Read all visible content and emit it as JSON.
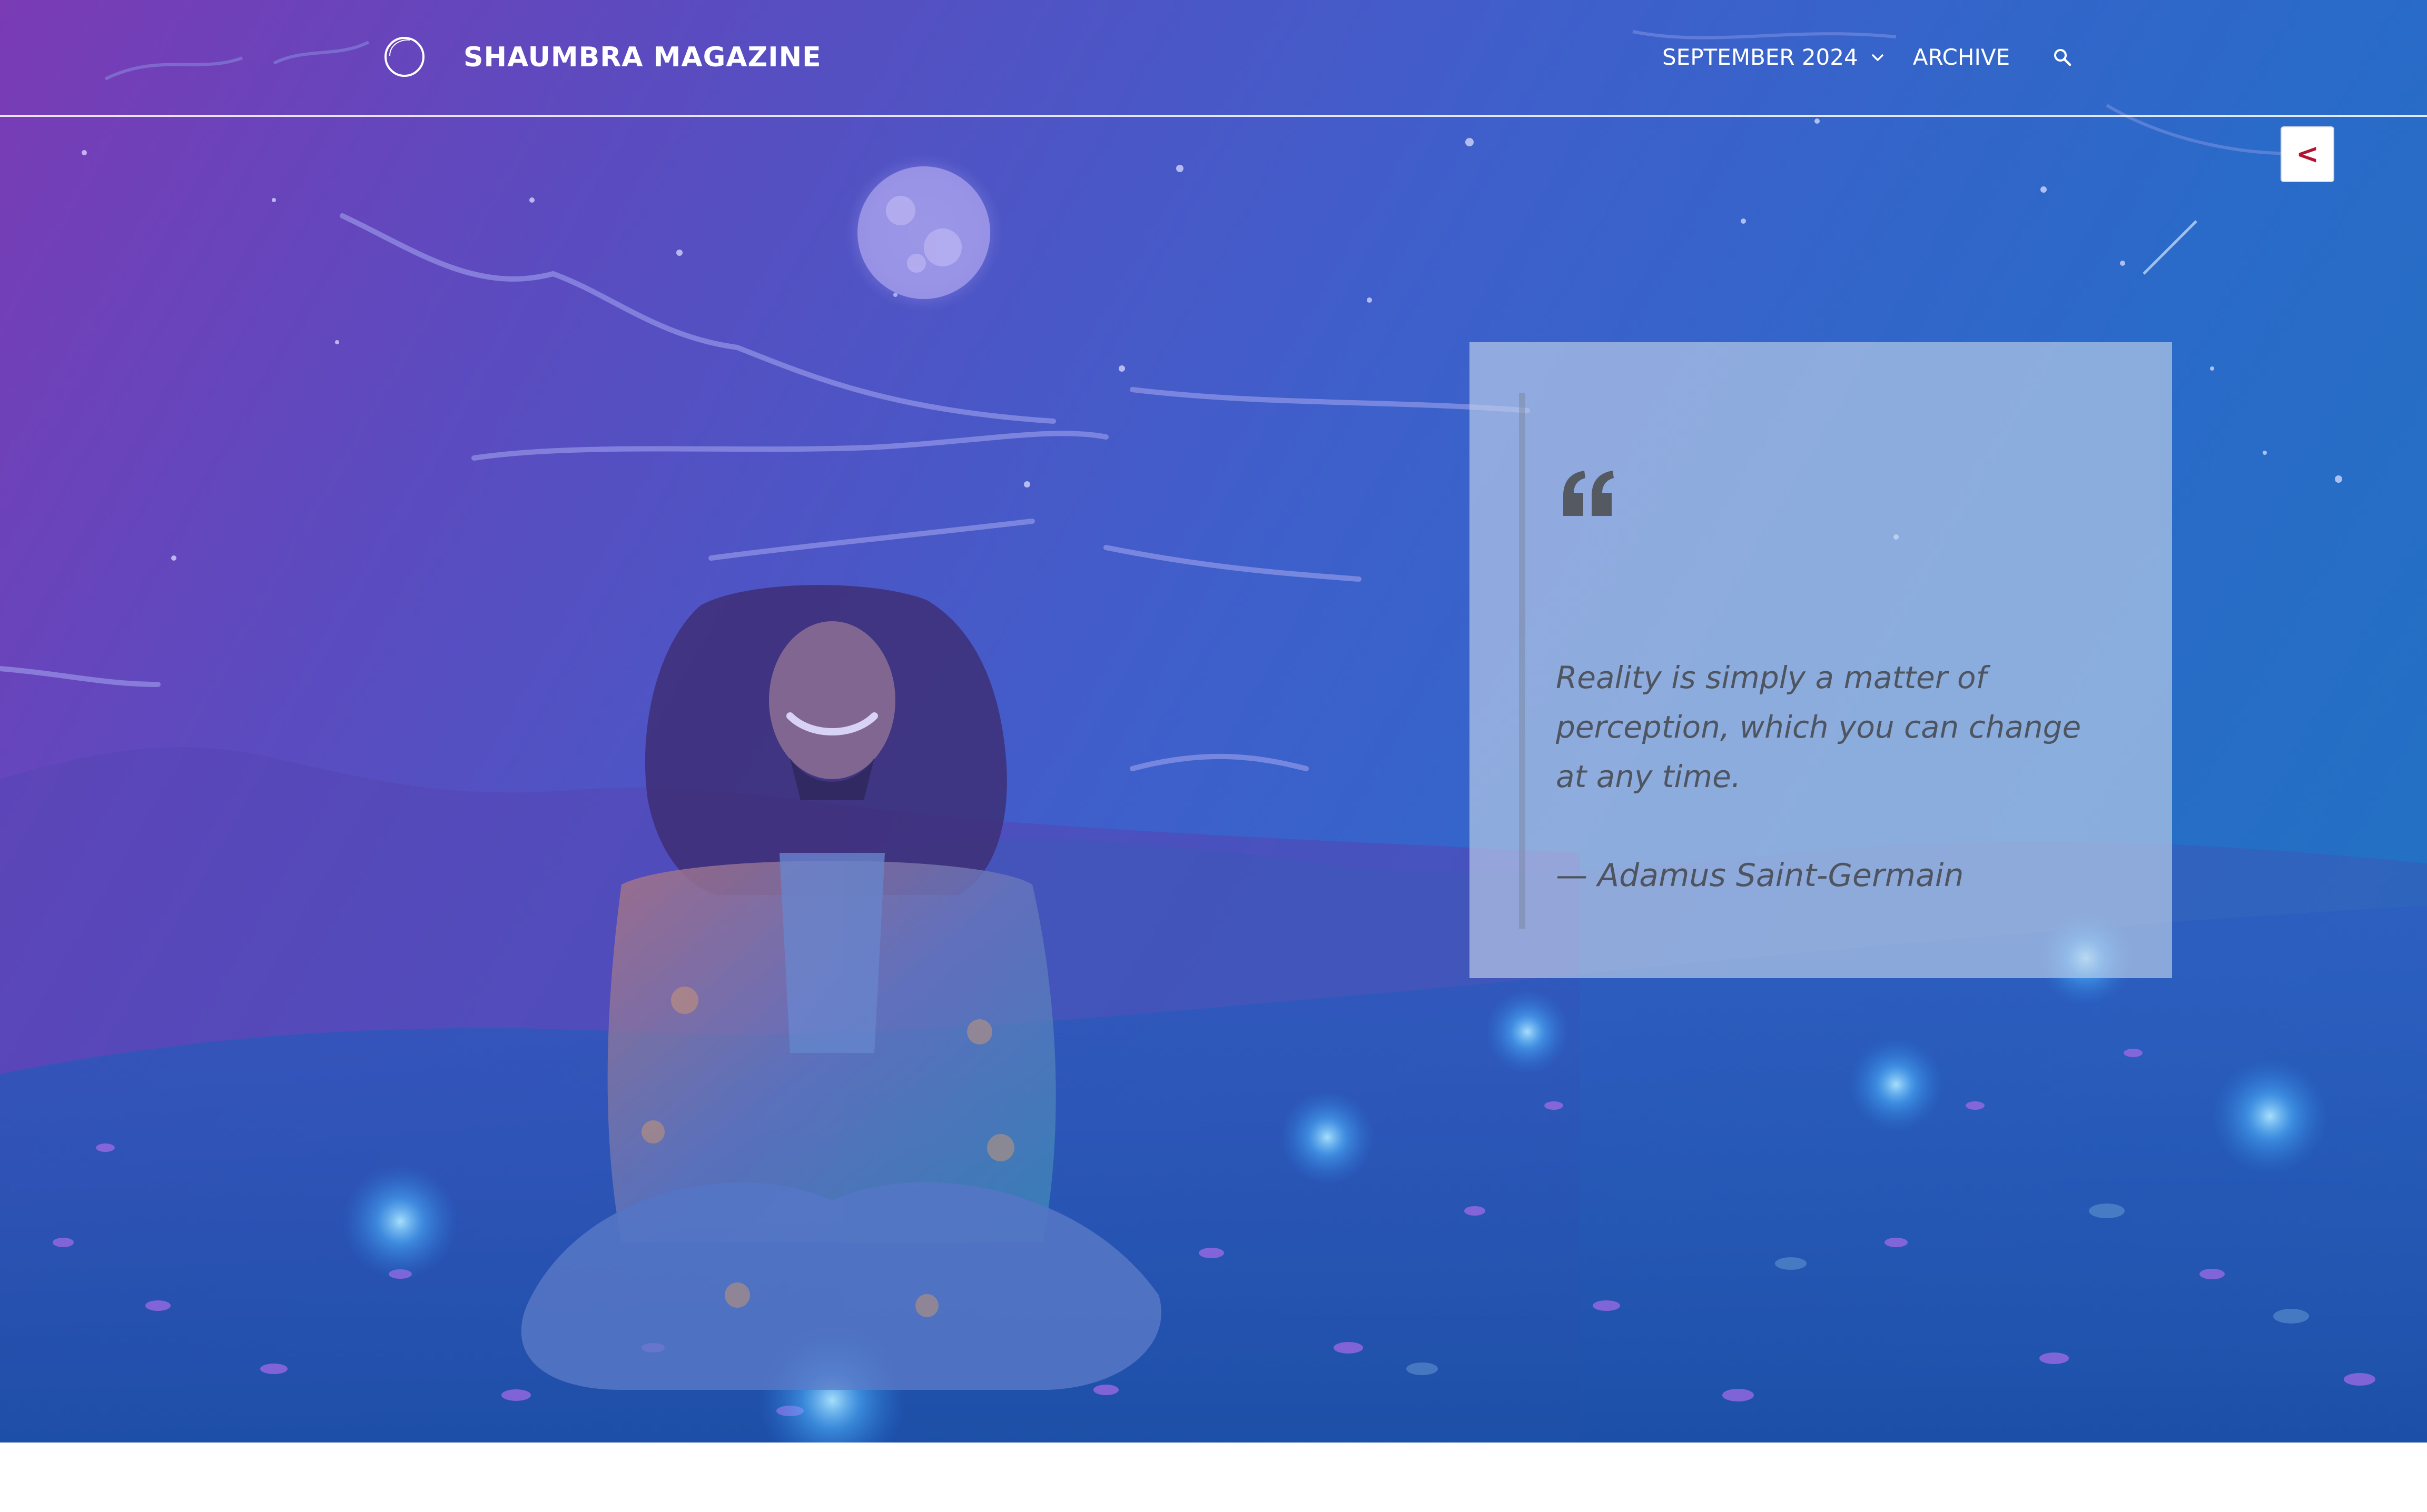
{
  "header": {
    "site_title": "SHAUMBRA MAGAZINE",
    "logo_icon": "circle-logo-icon"
  },
  "nav": {
    "issue_label": "SEPTEMBER 2024",
    "issue_icon": "chevron-down-icon",
    "archive_label": "ARCHIVE",
    "search_icon": "search-icon"
  },
  "back_button": {
    "label": "<"
  },
  "quote": {
    "mark_icon": "quotation-mark-icon",
    "text": "Reality is simply a matter of perception, which you can change at any time.",
    "author": "— Adamus Saint-Germain"
  },
  "colors": {
    "header_text": "#ffffff",
    "back_button_text": "#b3132f",
    "quote_text": "#4e5560",
    "hero_gradient_start": "#7a3bb5",
    "hero_gradient_end": "#1f74c2"
  }
}
